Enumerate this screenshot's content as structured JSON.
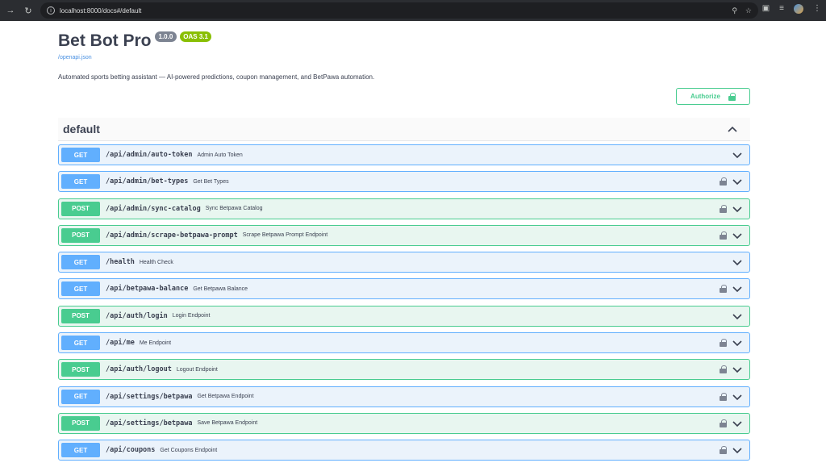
{
  "browser": {
    "url": "localhost:8000/docs#/default"
  },
  "info": {
    "title": "Bet Bot Pro",
    "version": "1.0.0",
    "oas": "OAS 3.1",
    "spec_link": "/openapi.json",
    "description": "Automated sports betting assistant — AI-powered predictions, coupon management, and BetPawa automation."
  },
  "authorize": {
    "label": "Authorize"
  },
  "section": {
    "title": "default"
  },
  "operations": [
    {
      "method": "GET",
      "path": "/api/admin/auto-token",
      "summary": "Admin Auto Token",
      "locked": false
    },
    {
      "method": "GET",
      "path": "/api/admin/bet-types",
      "summary": "Get Bet Types",
      "locked": true
    },
    {
      "method": "POST",
      "path": "/api/admin/sync-catalog",
      "summary": "Sync Betpawa Catalog",
      "locked": true
    },
    {
      "method": "POST",
      "path": "/api/admin/scrape-betpawa-prompt",
      "summary": "Scrape Betpawa Prompt Endpoint",
      "locked": true
    },
    {
      "method": "GET",
      "path": "/health",
      "summary": "Health Check",
      "locked": false
    },
    {
      "method": "GET",
      "path": "/api/betpawa-balance",
      "summary": "Get Betpawa Balance",
      "locked": true
    },
    {
      "method": "POST",
      "path": "/api/auth/login",
      "summary": "Login Endpoint",
      "locked": false
    },
    {
      "method": "GET",
      "path": "/api/me",
      "summary": "Me Endpoint",
      "locked": true
    },
    {
      "method": "POST",
      "path": "/api/auth/logout",
      "summary": "Logout Endpoint",
      "locked": true
    },
    {
      "method": "GET",
      "path": "/api/settings/betpawa",
      "summary": "Get Betpawa Endpoint",
      "locked": true
    },
    {
      "method": "POST",
      "path": "/api/settings/betpawa",
      "summary": "Save Betpawa Endpoint",
      "locked": true
    },
    {
      "method": "GET",
      "path": "/api/coupons",
      "summary": "Get Coupons Endpoint",
      "locked": true
    }
  ]
}
